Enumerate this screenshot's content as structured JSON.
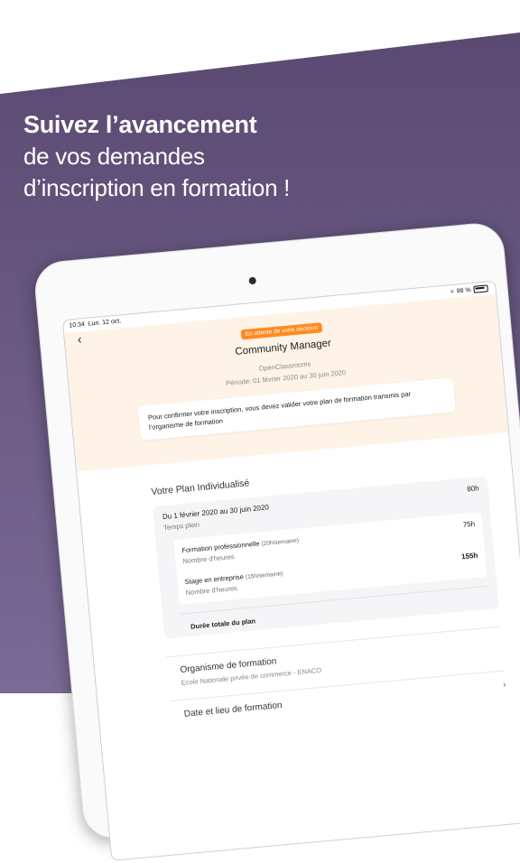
{
  "headline": {
    "line1": "Suivez l’avancement",
    "line2": "de vos demandes",
    "line3": "d’inscription en formation !"
  },
  "colors": {
    "background_top": "#5a4a72",
    "background_bottom": "#7a6a96",
    "badge": "#ff8a1f",
    "header_bg": "#fff3e7"
  },
  "statusbar": {
    "time": "10:34",
    "date": "Lun. 12 oct.",
    "battery": "98 %"
  },
  "header": {
    "back_icon": "chevron-left-icon",
    "status_badge": "En attente de votre décision",
    "title": "Community Manager",
    "provider": "OpenClassrooms",
    "period": "Période: 01 février 2020 au 30 juin 2020",
    "notice": "Pour confirmer votre inscription, vous devez valider votre plan de formation transmis par l’organisme de formation"
  },
  "plan": {
    "title": "Votre Plan Individualisé",
    "range": "Du 1 février 2020 au 30 juin 2020",
    "range_sub": "Temps plein",
    "range_amount": "80h",
    "items": [
      {
        "name": "Formation professionnelle",
        "detail": "(20h/semaine)",
        "sub": "Nombre d'heures",
        "amount": "75h"
      },
      {
        "name": "Stage en entreprise",
        "detail": "(15h/semaine)",
        "sub": "Nombre d'heures",
        "amount": "155h"
      }
    ],
    "total_label": "Durée totale du plan"
  },
  "organisme": {
    "label": "Organisme de formation",
    "value": "Ecole Nationale privée de commerce - ENACO"
  },
  "lieu": {
    "label": "Date et lieu de formation",
    "chevron_icon": "chevron-right-icon"
  }
}
